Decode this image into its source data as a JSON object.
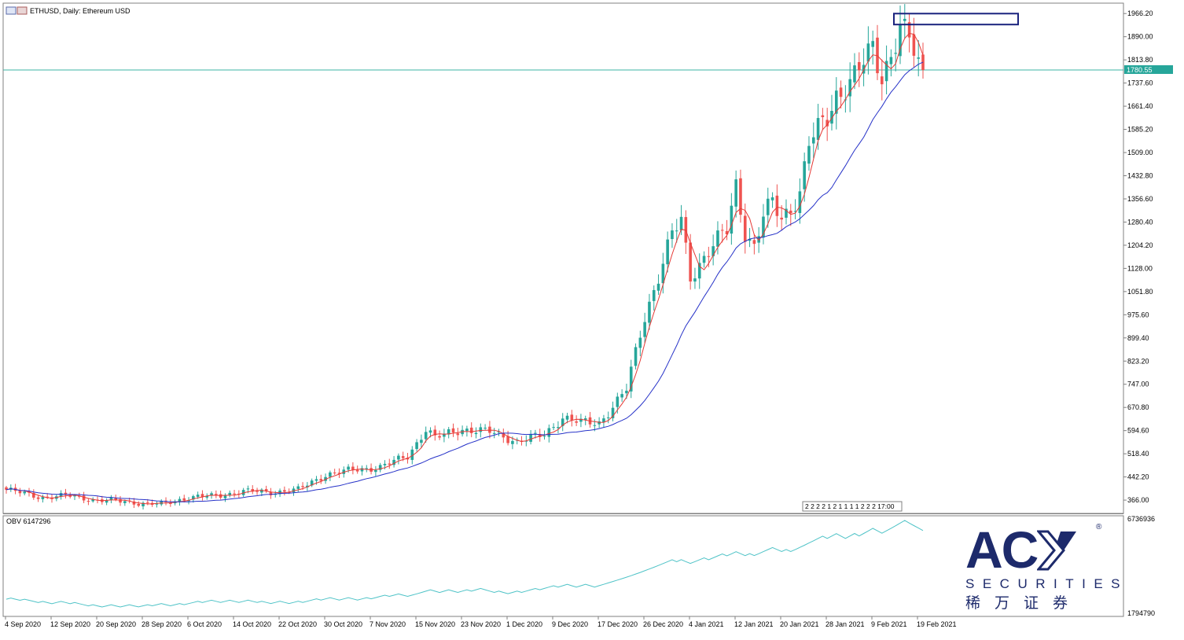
{
  "header": {
    "title": "ETHUSD, Daily:  Ethereum USD",
    "obv_label": "OBV 6147296"
  },
  "price_axis": {
    "ticks": [
      "1966.20",
      "1890.00",
      "1813.80",
      "1737.60",
      "1661.40",
      "1585.20",
      "1509.00",
      "1432.80",
      "1356.60",
      "1280.40",
      "1204.20",
      "1128.00",
      "1051.80",
      "975.60",
      "899.40",
      "823.20",
      "747.00",
      "670.80",
      "594.60",
      "518.40",
      "442.20",
      "366.00"
    ],
    "current_price": "1780.55"
  },
  "obv_axis": {
    "ticks": [
      "6736936",
      "1794790"
    ]
  },
  "date_axis": {
    "labels": [
      "4 Sep 2020",
      "12 Sep 2020",
      "20 Sep 2020",
      "28 Sep 2020",
      "6 Oct 2020",
      "14 Oct 2020",
      "22 Oct 2020",
      "30 Oct 2020",
      "7 Nov 2020",
      "15 Nov 2020",
      "23 Nov 2020",
      "1 Dec 2020",
      "9 Dec 2020",
      "17 Dec 2020",
      "26 Dec 2020",
      "4 Jan 2021",
      "12 Jan 2021",
      "20 Jan 2021",
      "28 Jan 2021",
      "9 Feb 2021",
      "19 Feb 2021"
    ]
  },
  "overlay_label": "2 2 2 2 1 2 1 1 1 1 2 2 2 17:00",
  "logo": {
    "main": "AC",
    "sub": "SECURITIES",
    "cn": "稀万证券",
    "reg": "®"
  },
  "colors": {
    "bull": "#26a69a",
    "bear": "#ef5350",
    "ma_fast": "#e53935",
    "ma_slow": "#2632c8",
    "obv": "#4fc3c7",
    "price_line": "#3cb4a4",
    "box": "#1a237e"
  },
  "chart_data": {
    "type": "candlestick",
    "symbol": "ETHUSD",
    "timeframe": "Daily",
    "ylim": [
      330,
      1990
    ],
    "grid": false,
    "anchors": [
      [
        0,
        400
      ],
      [
        8,
        375
      ],
      [
        14,
        380
      ],
      [
        20,
        365
      ],
      [
        26,
        362
      ],
      [
        30,
        355
      ],
      [
        34,
        352
      ],
      [
        40,
        375
      ],
      [
        46,
        380
      ],
      [
        52,
        395
      ],
      [
        58,
        392
      ],
      [
        64,
        400
      ],
      [
        70,
        450
      ],
      [
        76,
        465
      ],
      [
        82,
        475
      ],
      [
        88,
        510
      ],
      [
        92,
        600
      ],
      [
        94,
        570
      ],
      [
        100,
        600
      ],
      [
        106,
        590
      ],
      [
        112,
        560
      ],
      [
        118,
        580
      ],
      [
        122,
        640
      ],
      [
        126,
        620
      ],
      [
        130,
        620
      ],
      [
        136,
        730
      ],
      [
        140,
        970
      ],
      [
        146,
        1240
      ],
      [
        148,
        1280
      ],
      [
        150,
        1100
      ],
      [
        154,
        1190
      ],
      [
        158,
        1250
      ],
      [
        160,
        1400
      ],
      [
        162,
        1250
      ],
      [
        164,
        1200
      ],
      [
        166,
        1300
      ],
      [
        168,
        1340
      ],
      [
        170,
        1290
      ],
      [
        172,
        1330
      ],
      [
        174,
        1380
      ],
      [
        176,
        1540
      ],
      [
        180,
        1620
      ],
      [
        182,
        1700
      ],
      [
        186,
        1760
      ],
      [
        188,
        1800
      ],
      [
        190,
        1850
      ],
      [
        192,
        1760
      ],
      [
        194,
        1840
      ],
      [
        196,
        1920
      ],
      [
        198,
        1880
      ],
      [
        200,
        1790
      ],
      [
        201,
        1780
      ]
    ],
    "obv_range": [
      1794790,
      6736936
    ],
    "obv_last": 6147296,
    "current_price": 1780.55,
    "highlight_box": [
      1930,
      1966
    ]
  }
}
